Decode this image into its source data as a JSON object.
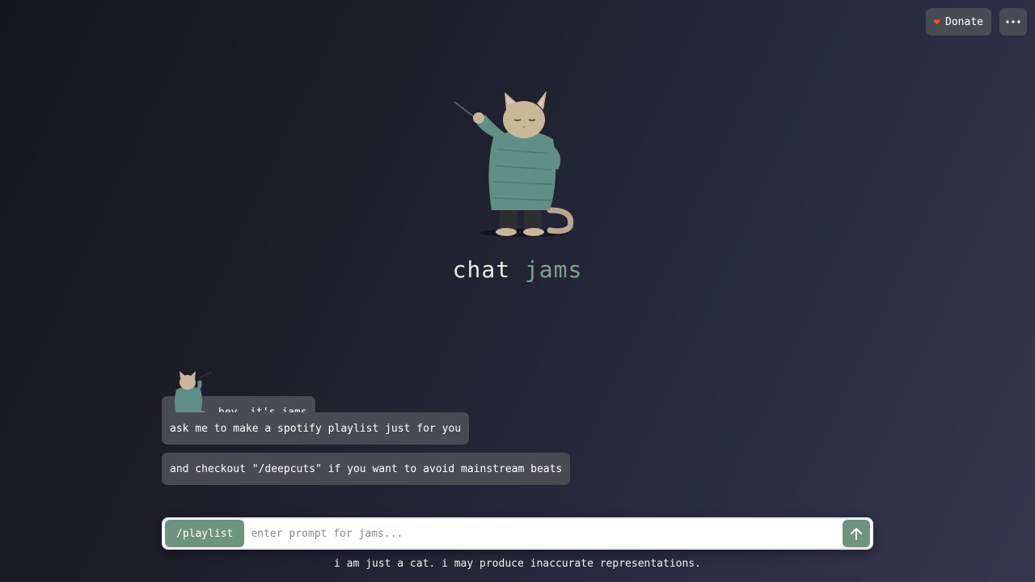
{
  "header": {
    "donate_label": "Donate",
    "heart_icon": "heart-icon",
    "menu_icon": "more-horizontal-icon",
    "heart_color": "#ff4a1c"
  },
  "hero": {
    "title_word1": "chat",
    "title_word2": "jams",
    "accent_color": "#7aa391"
  },
  "chat": {
    "messages": [
      {
        "text": "hey, it's jams"
      },
      {
        "text": "ask me to make a spotify playlist just for you"
      },
      {
        "text": "and checkout \"/deepcuts\" if you want to avoid mainstream beats"
      }
    ]
  },
  "composer": {
    "command_label": "/playlist",
    "placeholder": "enter prompt for jams...",
    "value": "",
    "send_icon": "arrow-up-icon"
  },
  "footer": {
    "disclaimer": "i am just a cat. i may produce inaccurate representations."
  }
}
